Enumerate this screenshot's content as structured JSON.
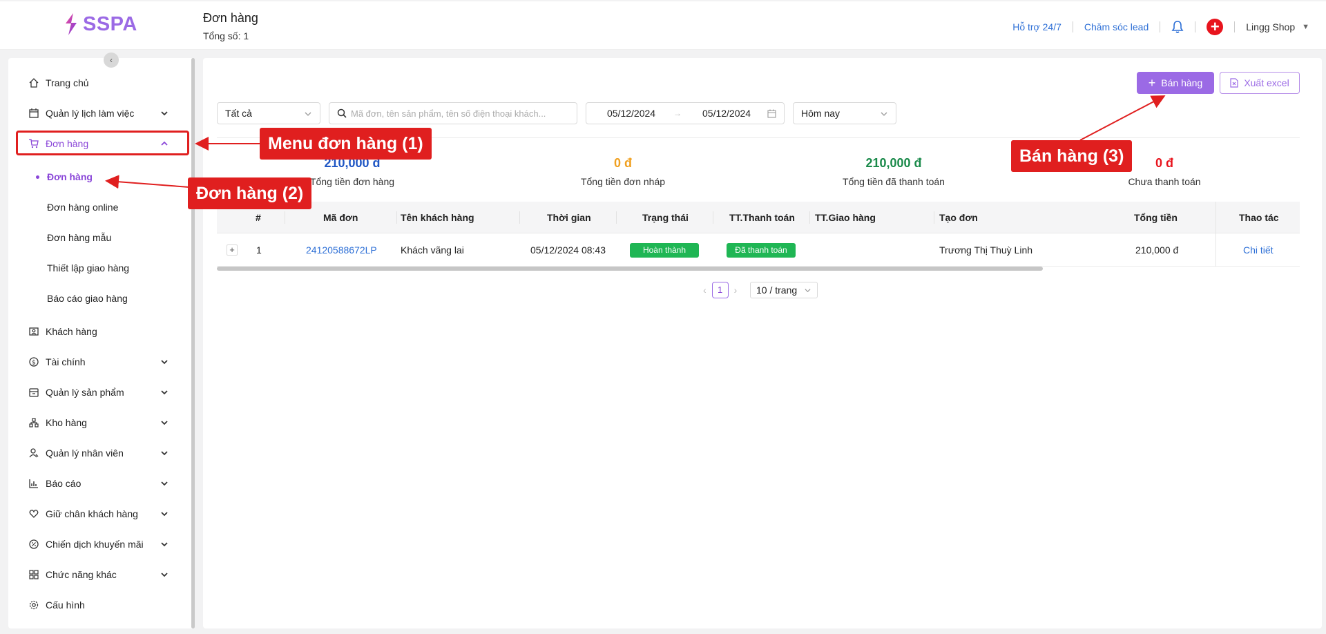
{
  "header": {
    "brand": "SSPA",
    "title": "Đơn hàng",
    "subtitle": "Tổng số: 1",
    "support_link": "Hỗ trợ 24/7",
    "lead_link": "Chăm sóc lead",
    "shop_name": "Lingg Shop"
  },
  "sidebar": {
    "items": [
      {
        "label": "Trang chủ",
        "icon": "home-icon"
      },
      {
        "label": "Quản lý lịch làm việc",
        "icon": "calendar-icon"
      },
      {
        "label": "Đơn hàng",
        "icon": "cart-icon"
      },
      {
        "label": "Khách hàng",
        "icon": "contact-card-icon"
      },
      {
        "label": "Tài chính",
        "icon": "dollar-circle-icon"
      },
      {
        "label": "Quản lý sản phẩm",
        "icon": "box-icon"
      },
      {
        "label": "Kho hàng",
        "icon": "warehouse-icon"
      },
      {
        "label": "Quản lý nhân viên",
        "icon": "staff-icon"
      },
      {
        "label": "Báo cáo",
        "icon": "chart-icon"
      },
      {
        "label": "Giữ chân khách hàng",
        "icon": "heart-icon"
      },
      {
        "label": "Chiến dịch khuyến mãi",
        "icon": "discount-icon"
      },
      {
        "label": "Chức năng khác",
        "icon": "apps-icon"
      },
      {
        "label": "Cấu hình",
        "icon": "gear-icon"
      }
    ],
    "orders_sub": [
      {
        "label": "Đơn hàng"
      },
      {
        "label": "Đơn hàng online"
      },
      {
        "label": "Đơn hàng mẫu"
      },
      {
        "label": "Thiết lập giao hàng"
      },
      {
        "label": "Báo cáo giao hàng"
      }
    ]
  },
  "toolbar": {
    "sell_button": "Bán hàng",
    "export_button": "Xuất excel",
    "status_select": "Tất cả",
    "search_placeholder": "Mã đơn, tên sản phẩm, tên số điện thoại khách...",
    "date_from": "05/12/2024",
    "date_to": "05/12/2024",
    "date_arrow": "→",
    "range_select": "Hôm nay"
  },
  "stats": [
    {
      "value": "210,000 đ",
      "label": "Tổng tiền đơn hàng",
      "color": "#1f56c4"
    },
    {
      "value": "0 đ",
      "label": "Tổng tiền đơn nháp",
      "color": "#f0a020"
    },
    {
      "value": "210,000 đ",
      "label": "Tổng tiền đã thanh toán",
      "color": "#1a8a4a"
    },
    {
      "value": "0 đ",
      "label": "Chưa thanh toán",
      "color": "#e8141d"
    }
  ],
  "table": {
    "columns": [
      "#",
      "Mã đơn",
      "Tên khách hàng",
      "Thời gian",
      "Trạng thái",
      "TT.Thanh toán",
      "TT.Giao hàng",
      "Tạo đơn",
      "Tổng tiền",
      "Thao tác"
    ],
    "rows": [
      {
        "index": "1",
        "order_id": "24120588672LP",
        "customer": "Khách vãng lai",
        "time": "05/12/2024 08:43",
        "status": "Hoàn thành",
        "payment": "Đã thanh toán",
        "shipping": "",
        "creator": "Trương Thị Thuỳ Linh",
        "total": "210,000 đ",
        "action": "Chi tiết"
      }
    ]
  },
  "pagination": {
    "current_page": "1",
    "page_size": "10 / trang"
  },
  "annotations": {
    "menu": "Menu đơn hàng (1)",
    "orders": "Đơn hàng (2)",
    "sell": "Bán hàng (3)"
  },
  "colors": {
    "accent": "#9b6ae5",
    "annotation": "#e01f1f",
    "success": "#1fb654",
    "link": "#2d6fd6"
  }
}
